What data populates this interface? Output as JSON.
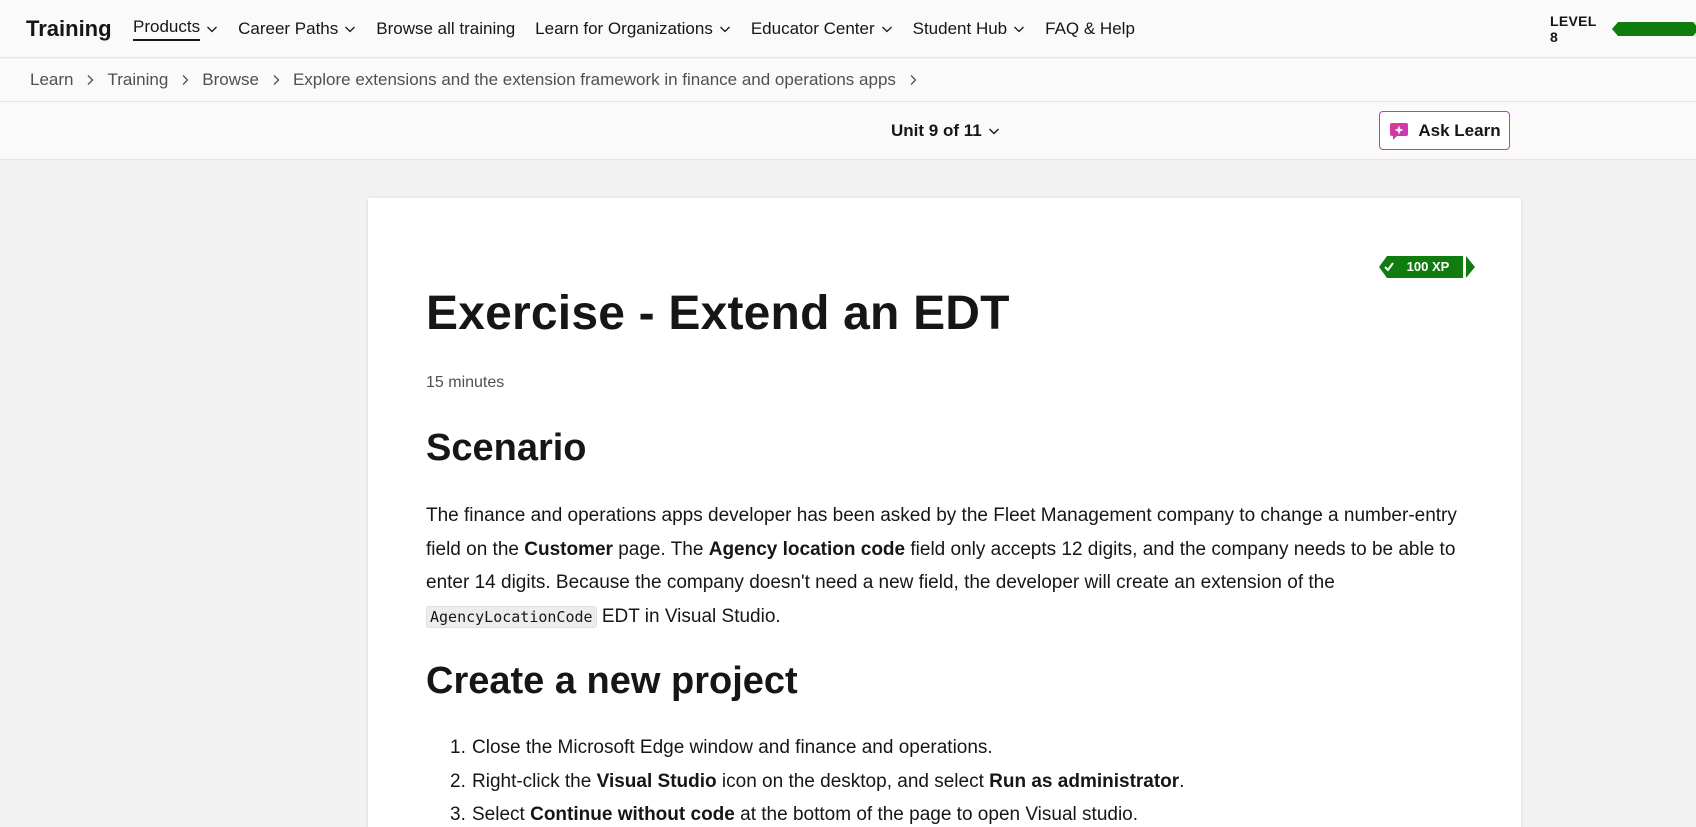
{
  "nav": {
    "brand": "Training",
    "items": [
      {
        "label": "Products",
        "dropdown": true,
        "active": true
      },
      {
        "label": "Career Paths",
        "dropdown": true
      },
      {
        "label": "Browse all training",
        "dropdown": false
      },
      {
        "label": "Learn for Organizations",
        "dropdown": true
      },
      {
        "label": "Educator Center",
        "dropdown": true
      },
      {
        "label": "Student Hub",
        "dropdown": true
      },
      {
        "label": "FAQ & Help",
        "dropdown": false
      }
    ],
    "level_label": "LEVEL 8",
    "level_progress": 0.9,
    "level_color": "#107c10"
  },
  "breadcrumb": {
    "items": [
      "Learn",
      "Training",
      "Browse",
      "Explore extensions and the extension framework in finance and operations apps"
    ]
  },
  "unitbar": {
    "unit_label": "Unit 9 of 11",
    "ask_learn_label": "Ask Learn",
    "ask_learn_icon": "sparkle-icon",
    "accent": "#c03bc4"
  },
  "content": {
    "xp_badge": "100 XP",
    "xp_color": "#107c10",
    "title": "Exercise - Extend an EDT",
    "duration": "15 minutes",
    "scenario_heading": "Scenario",
    "scenario": {
      "t1": "The finance and operations apps developer has been asked by the Fleet Management company to change a number-entry field on the ",
      "b1": "Customer",
      "t2": " page. The ",
      "b2": "Agency location code",
      "t3": " field only accepts 12 digits, and the company needs to be able to enter 14 digits. Because the company doesn't need a new field, the developer will create an extension of the ",
      "code": "AgencyLocationCode",
      "t4": " EDT in Visual Studio."
    },
    "create_heading": "Create a new project",
    "steps": [
      {
        "num": "1.",
        "t1": "Close the Microsoft Edge window and finance and operations.",
        "b1": "",
        "t2": "",
        "b2": "",
        "t3": ""
      },
      {
        "num": "2.",
        "t1": "Right-click the ",
        "b1": "Visual Studio",
        "t2": " icon on the desktop, and select ",
        "b2": "Run as administrator",
        "t3": "."
      },
      {
        "num": "3.",
        "t1": "Select ",
        "b1": "Continue without code",
        "t2": " at the bottom of the page to open Visual studio.",
        "b2": "",
        "t3": ""
      }
    ]
  }
}
